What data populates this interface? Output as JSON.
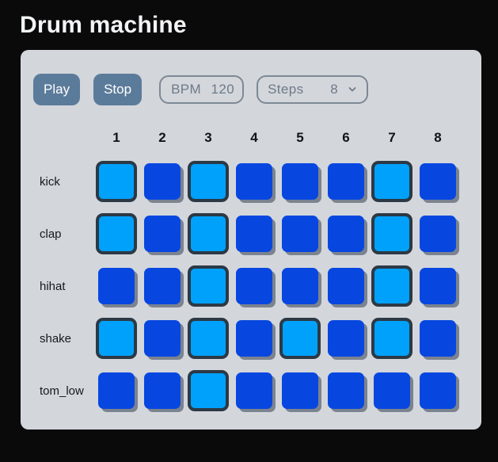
{
  "title": "Drum machine",
  "controls": {
    "play_label": "Play",
    "stop_label": "Stop",
    "bpm": {
      "label": "BPM",
      "value": "120"
    },
    "steps": {
      "label": "Steps",
      "value": "8"
    }
  },
  "sequencer": {
    "step_numbers": [
      "1",
      "2",
      "3",
      "4",
      "5",
      "6",
      "7",
      "8"
    ],
    "tracks": [
      {
        "name": "kick",
        "steps": [
          1,
          0,
          1,
          0,
          0,
          0,
          1,
          0
        ]
      },
      {
        "name": "clap",
        "steps": [
          1,
          0,
          1,
          0,
          0,
          0,
          1,
          0
        ]
      },
      {
        "name": "hihat",
        "steps": [
          0,
          0,
          1,
          0,
          0,
          0,
          1,
          0
        ]
      },
      {
        "name": "shake",
        "steps": [
          1,
          0,
          1,
          0,
          1,
          0,
          1,
          0
        ]
      },
      {
        "name": "tom_low",
        "steps": [
          0,
          0,
          1,
          0,
          0,
          0,
          0,
          0
        ]
      }
    ]
  },
  "colors": {
    "page_bg": "#0a0a0b",
    "panel_bg": "#d3d6db",
    "button_bg": "#5b7b9a",
    "button_text": "#ffffff",
    "outline_border": "#7e8995",
    "outline_text": "#6e7a89",
    "pad_active_fill": "#00a1fb",
    "pad_active_border": "#2c3945",
    "pad_inactive_fill": "#0747e0",
    "pad_shadow": "#7b838f",
    "step_number_text": "#101419",
    "track_label_text": "#15191e"
  }
}
